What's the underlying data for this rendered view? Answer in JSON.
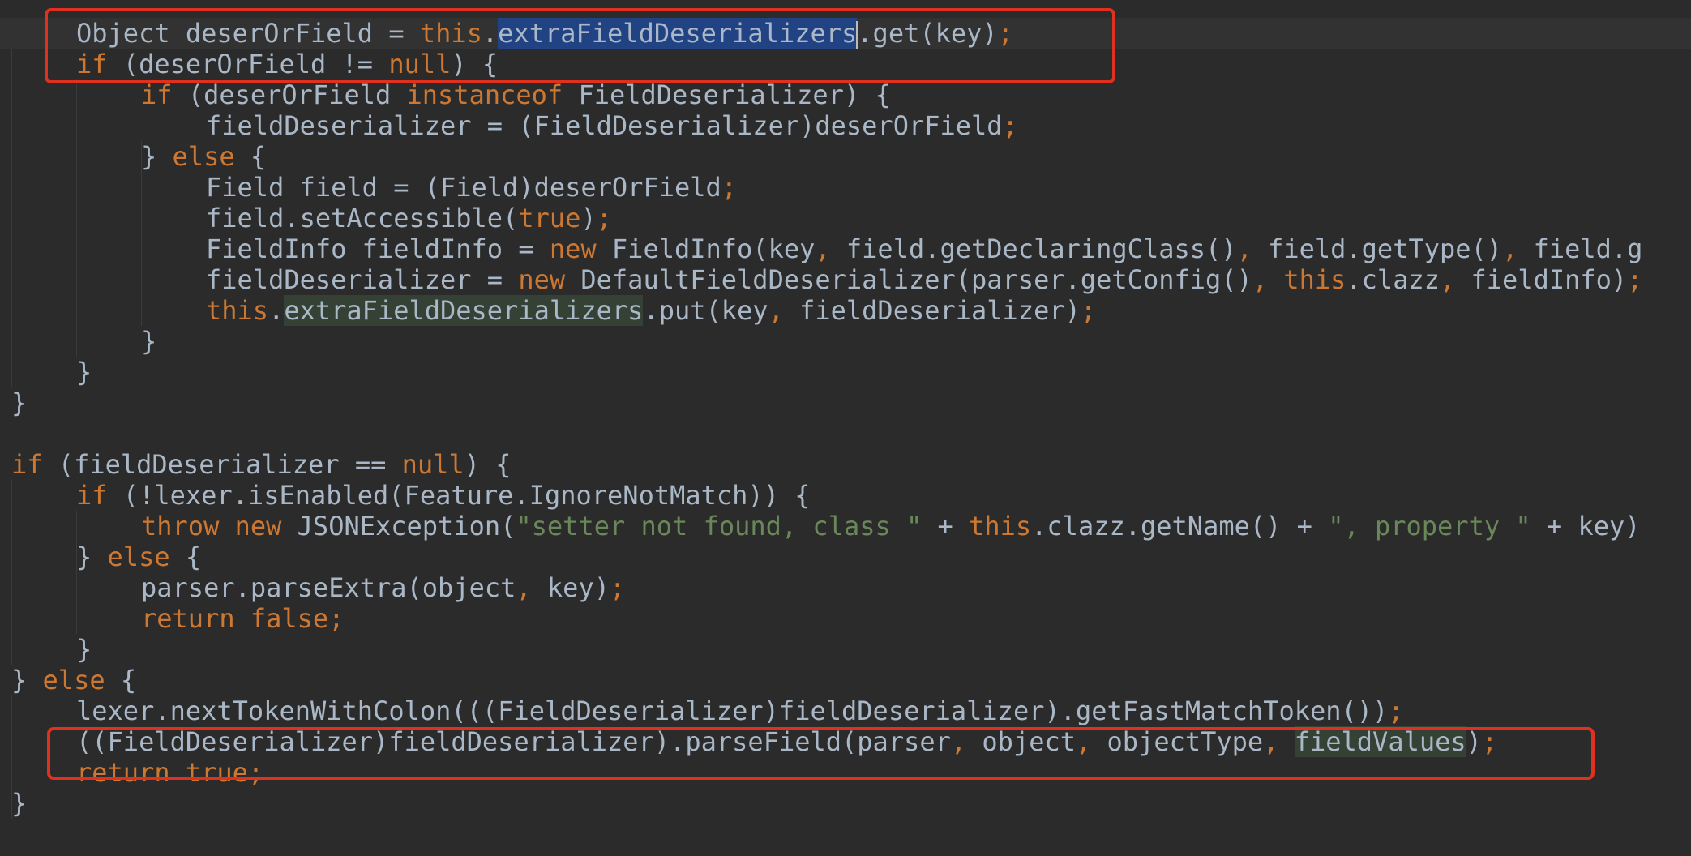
{
  "editor": {
    "lines": [
      {
        "indent": 4,
        "current": true,
        "caret": {
          "token": 3,
          "offset": 23
        },
        "tokens": [
          {
            "t": "Object deserOrField = ",
            "c": "txt"
          },
          {
            "t": "this",
            "c": "kw"
          },
          {
            "t": ".",
            "c": "txt"
          },
          {
            "t": "extraFieldDeserializers",
            "c": "txt",
            "hl": "sel"
          },
          {
            "t": ".get(key)",
            "c": "txt"
          },
          {
            "t": ";",
            "c": "kw"
          }
        ]
      },
      {
        "indent": 4,
        "tokens": [
          {
            "t": "if",
            "c": "kw"
          },
          {
            "t": " (deserOrField != ",
            "c": "txt"
          },
          {
            "t": "null",
            "c": "kw"
          },
          {
            "t": ") {",
            "c": "txt"
          }
        ]
      },
      {
        "indent": 8,
        "tokens": [
          {
            "t": "if",
            "c": "kw"
          },
          {
            "t": " (deserOrField ",
            "c": "txt"
          },
          {
            "t": "instanceof",
            "c": "kw"
          },
          {
            "t": " FieldDeserializer) {",
            "c": "txt"
          }
        ]
      },
      {
        "indent": 12,
        "tokens": [
          {
            "t": "fieldDeserializer = (FieldDeserializer)deserOrField",
            "c": "txt"
          },
          {
            "t": ";",
            "c": "kw"
          }
        ]
      },
      {
        "indent": 8,
        "tokens": [
          {
            "t": "} ",
            "c": "txt"
          },
          {
            "t": "else",
            "c": "kw"
          },
          {
            "t": " {",
            "c": "txt"
          }
        ]
      },
      {
        "indent": 12,
        "tokens": [
          {
            "t": "Field field = (Field)deserOrField",
            "c": "txt"
          },
          {
            "t": ";",
            "c": "kw"
          }
        ]
      },
      {
        "indent": 12,
        "tokens": [
          {
            "t": "field.setAccessible(",
            "c": "txt"
          },
          {
            "t": "true",
            "c": "kw"
          },
          {
            "t": ")",
            "c": "txt"
          },
          {
            "t": ";",
            "c": "kw"
          }
        ]
      },
      {
        "indent": 12,
        "tokens": [
          {
            "t": "FieldInfo fieldInfo = ",
            "c": "txt"
          },
          {
            "t": "new",
            "c": "kw"
          },
          {
            "t": " FieldInfo(key",
            "c": "txt"
          },
          {
            "t": ",",
            "c": "kw"
          },
          {
            "t": " field.getDeclaringClass()",
            "c": "txt"
          },
          {
            "t": ",",
            "c": "kw"
          },
          {
            "t": " field.getType()",
            "c": "txt"
          },
          {
            "t": ",",
            "c": "kw"
          },
          {
            "t": " field.g",
            "c": "txt"
          }
        ]
      },
      {
        "indent": 12,
        "tokens": [
          {
            "t": "fieldDeserializer = ",
            "c": "txt"
          },
          {
            "t": "new",
            "c": "kw"
          },
          {
            "t": " DefaultFieldDeserializer(parser.getConfig()",
            "c": "txt"
          },
          {
            "t": ",",
            "c": "kw"
          },
          {
            "t": " ",
            "c": "txt"
          },
          {
            "t": "this",
            "c": "kw"
          },
          {
            "t": ".clazz",
            "c": "txt"
          },
          {
            "t": ",",
            "c": "kw"
          },
          {
            "t": " fieldInfo)",
            "c": "txt"
          },
          {
            "t": ";",
            "c": "kw"
          }
        ]
      },
      {
        "indent": 12,
        "tokens": [
          {
            "t": "this",
            "c": "kw"
          },
          {
            "t": ".",
            "c": "txt"
          },
          {
            "t": "extraFieldDeserializers",
            "c": "txt",
            "hl": "read"
          },
          {
            "t": ".put(key",
            "c": "txt"
          },
          {
            "t": ",",
            "c": "kw"
          },
          {
            "t": " fieldDeserializer)",
            "c": "txt"
          },
          {
            "t": ";",
            "c": "kw"
          }
        ]
      },
      {
        "indent": 8,
        "tokens": [
          {
            "t": "}",
            "c": "txt"
          }
        ]
      },
      {
        "indent": 4,
        "tokens": [
          {
            "t": "}",
            "c": "txt"
          }
        ]
      },
      {
        "indent": 0,
        "tokens": [
          {
            "t": "}",
            "c": "txt"
          }
        ]
      },
      {
        "indent": 0,
        "tokens": []
      },
      {
        "indent": 0,
        "tokens": [
          {
            "t": "if",
            "c": "kw"
          },
          {
            "t": " (fieldDeserializer == ",
            "c": "txt"
          },
          {
            "t": "null",
            "c": "kw"
          },
          {
            "t": ") {",
            "c": "txt"
          }
        ]
      },
      {
        "indent": 4,
        "tokens": [
          {
            "t": "if",
            "c": "kw"
          },
          {
            "t": " (!lexer.isEnabled(Feature.IgnoreNotMatch)) {",
            "c": "txt"
          }
        ]
      },
      {
        "indent": 8,
        "tokens": [
          {
            "t": "throw",
            "c": "kw"
          },
          {
            "t": " ",
            "c": "txt"
          },
          {
            "t": "new",
            "c": "kw"
          },
          {
            "t": " JSONException(",
            "c": "txt"
          },
          {
            "t": "\"setter not found, class \"",
            "c": "str"
          },
          {
            "t": " + ",
            "c": "txt"
          },
          {
            "t": "this",
            "c": "kw"
          },
          {
            "t": ".clazz.getName() + ",
            "c": "txt"
          },
          {
            "t": "\", property \"",
            "c": "str"
          },
          {
            "t": " + key)",
            "c": "txt"
          }
        ]
      },
      {
        "indent": 4,
        "tokens": [
          {
            "t": "} ",
            "c": "txt"
          },
          {
            "t": "else",
            "c": "kw"
          },
          {
            "t": " {",
            "c": "txt"
          }
        ]
      },
      {
        "indent": 8,
        "tokens": [
          {
            "t": "parser.parseExtra(object",
            "c": "txt"
          },
          {
            "t": ",",
            "c": "kw"
          },
          {
            "t": " key)",
            "c": "txt"
          },
          {
            "t": ";",
            "c": "kw"
          }
        ]
      },
      {
        "indent": 8,
        "tokens": [
          {
            "t": "return false",
            "c": "kw"
          },
          {
            "t": ";",
            "c": "kw"
          }
        ]
      },
      {
        "indent": 4,
        "tokens": [
          {
            "t": "}",
            "c": "txt"
          }
        ]
      },
      {
        "indent": 0,
        "tokens": [
          {
            "t": "} ",
            "c": "txt"
          },
          {
            "t": "else",
            "c": "kw"
          },
          {
            "t": " {",
            "c": "txt"
          }
        ]
      },
      {
        "indent": 4,
        "tokens": [
          {
            "t": "lexer.nextTokenWithColon(((FieldDeserializer)fieldDeserializer).getFastMatchToken())",
            "c": "txt"
          },
          {
            "t": ";",
            "c": "kw"
          }
        ]
      },
      {
        "indent": 4,
        "tokens": [
          {
            "t": "((FieldDeserializer)fieldDeserializer).parseField(parser",
            "c": "txt"
          },
          {
            "t": ",",
            "c": "kw"
          },
          {
            "t": " object",
            "c": "txt"
          },
          {
            "t": ",",
            "c": "kw"
          },
          {
            "t": " objectType",
            "c": "txt"
          },
          {
            "t": ",",
            "c": "kw"
          },
          {
            "t": " ",
            "c": "txt"
          },
          {
            "t": "fieldValues",
            "c": "txt",
            "hl": "read"
          },
          {
            "t": ")",
            "c": "txt"
          },
          {
            "t": ";",
            "c": "kw"
          }
        ]
      },
      {
        "indent": 4,
        "tokens": [
          {
            "t": "return true",
            "c": "kw"
          },
          {
            "t": ";",
            "c": "kw"
          }
        ]
      },
      {
        "indent": 0,
        "tokens": [
          {
            "t": "}",
            "c": "txt"
          }
        ]
      }
    ]
  },
  "colors": {
    "background": "#2b2b2b",
    "current_line": "#323232",
    "text": "#a9b7c6",
    "keyword": "#cc7832",
    "string": "#6a8759",
    "selection": "#214283",
    "usage_highlight": "#344134",
    "callout": "#e0301e"
  }
}
